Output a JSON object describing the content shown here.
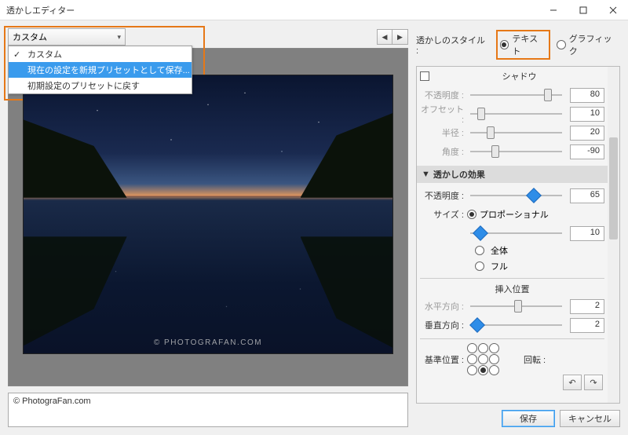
{
  "window": {
    "title": "透かしエディター"
  },
  "preset": {
    "selected": "カスタム",
    "options": [
      "カスタム",
      "現在の設定を新規プリセットとして保存...",
      "初期設定のプリセットに戻す"
    ]
  },
  "watermark_text": "© PhotograFan.com",
  "watermark_on_image": "© PHOTOGRAFAN.COM",
  "style": {
    "label": "透かしのスタイル :",
    "text": "テキスト",
    "graphic": "グラフィック",
    "value": "text"
  },
  "shadow": {
    "title": "シャドウ",
    "enabled": false,
    "opacity_label": "不透明度 :",
    "opacity": 80,
    "offset_label": "オフセット :",
    "offset": 10,
    "radius_label": "半径 :",
    "radius": 20,
    "angle_label": "角度 :",
    "angle": -90
  },
  "effects": {
    "title": "透かしの効果",
    "opacity_label": "不透明度 :",
    "opacity": 65,
    "size_label": "サイズ :",
    "size_mode": "proportional",
    "proportional": "プロポーショナル",
    "fit": "全体",
    "fill": "フル",
    "size_value": 10,
    "inset_title": "挿入位置",
    "h_label": "水平方向 :",
    "h_value": 2,
    "v_label": "垂直方向 :",
    "v_value": 2
  },
  "anchor": {
    "label": "基準位置 :",
    "rotate_label": "回転 :",
    "selected": 7
  },
  "buttons": {
    "save": "保存",
    "cancel": "キャンセル"
  }
}
